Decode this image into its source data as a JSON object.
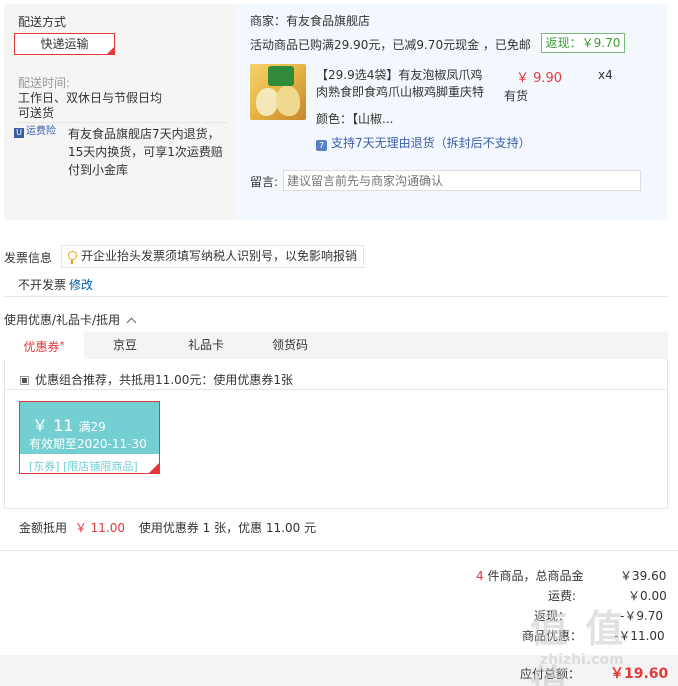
{
  "shipping": {
    "title": "配送方式",
    "method_label": "快递运输",
    "time_label": "配送时间:",
    "time_value": "工作日、双休日与节假日均",
    "time_value2": "可送货",
    "insurance_icon_label": "运费险",
    "insurance_line1": "有友食品旗舰店7天内退货，",
    "insurance_line2": "15天内换货，可享1次运费赔",
    "insurance_line3": "付到小金库"
  },
  "store": {
    "merchant_label": "商家：有友食品旗舰店",
    "promo_text": "活动商品已购满29.90元，已减9.70元现金 ，已免邮",
    "return_badge": "返现：￥9.70",
    "product_title_line1": "【29.9选4袋】有友泡椒凤爪鸡",
    "product_title_line2": "肉熟食即食鸡爪山椒鸡脚重庆特",
    "price": "￥ 9.90",
    "quantity": "x4",
    "stock": "有货",
    "color_label": "颜色：【山椒...",
    "service_icon": "7",
    "service_text": "支持7天无理由退货（拆封后不支持）",
    "message_label": "留言:",
    "message_placeholder": "建议留言前先与商家沟通确认"
  },
  "invoice": {
    "title": "发票信息",
    "tip": "开企业抬头发票须填写纳税人识别号，以免影响报销",
    "status": "不开发票",
    "edit_link": "修改"
  },
  "coupons": {
    "section_title": "使用优惠/礼品卡/抵用",
    "tabs": [
      {
        "label": "优惠券",
        "mark": "*"
      },
      {
        "label": "京豆"
      },
      {
        "label": "礼品卡"
      },
      {
        "label": "领货码"
      }
    ],
    "recommend_text": "优惠组合推荐，共抵用11.00元：使用优惠券1张",
    "coupon": {
      "amount": "￥ 11",
      "threshold": "满29",
      "expiry": "有效期至2020-11-30",
      "tag": "[东券] [限店铺限商品]"
    },
    "deduct_label": "金额抵用",
    "deduct_amount": "￥ 11.00",
    "deduct_note": "使用优惠券 1 张，优惠 11.00 元"
  },
  "summary": {
    "count": "4",
    "count_suffix": "件商品，总商品金",
    "total_goods": "￥39.60",
    "freight_label": "运费:",
    "freight": "￥0.00",
    "return_label": "返现：",
    "return_value": "-￥9.70",
    "discount_label": "商品优惠：",
    "discount_value": "-￥11.00",
    "payable_label": "应付总额：",
    "payable": "￥19.60"
  },
  "watermark": {
    "text": "值 值 值",
    "url": "zhizhi.com"
  }
}
